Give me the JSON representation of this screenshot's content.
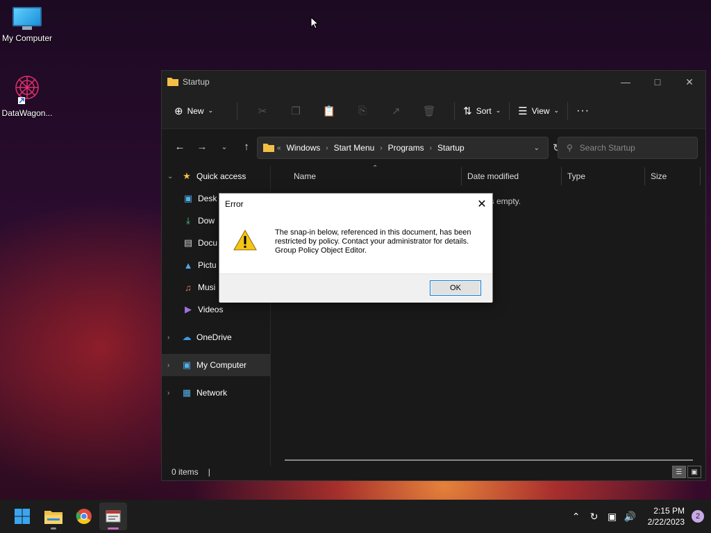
{
  "desktop": {
    "icons": [
      {
        "label": "My Computer",
        "icon": "monitor-icon"
      },
      {
        "label": "DataWagon...",
        "icon": "datawagon-icon"
      }
    ]
  },
  "explorer": {
    "title": "Startup",
    "toolbar": {
      "new_label": "New",
      "sort_label": "Sort",
      "view_label": "View",
      "more_label": "···"
    },
    "breadcrumb": [
      "Windows",
      "Start Menu",
      "Programs",
      "Startup"
    ],
    "search_placeholder": "Search Startup",
    "nav": {
      "quick_access": "Quick access",
      "quick_items": [
        "Desk",
        "Dow",
        "Docu",
        "Pictu",
        "Musi",
        "Videos"
      ],
      "onedrive": "OneDrive",
      "my_computer": "My Computer",
      "network": "Network"
    },
    "columns": [
      "Name",
      "Date modified",
      "Type",
      "Size"
    ],
    "empty_text": "is empty.",
    "status": "0 items"
  },
  "dialog": {
    "title": "Error",
    "message_lines": [
      "The snap-in below, referenced in this document, has been",
      "restricted by policy. Contact your administrator for details.",
      "Group Policy Object Editor."
    ],
    "ok_label": "OK"
  },
  "taskbar": {
    "time": "2:15 PM",
    "date": "2/22/2023",
    "notifications": "2"
  }
}
